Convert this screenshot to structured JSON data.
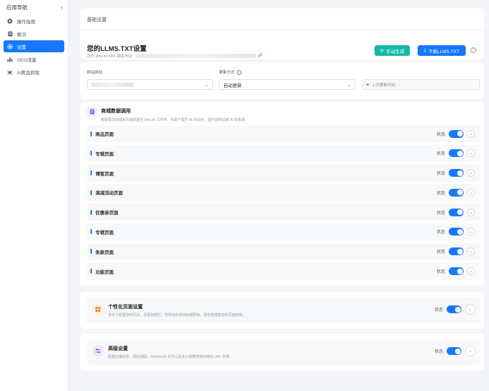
{
  "sidebar": {
    "title": "应用导航",
    "collapse_icon": "chevron-left-icon",
    "items": [
      {
        "label": "操作指南",
        "icon": "compass-icon",
        "active": false
      },
      {
        "label": "概况",
        "icon": "document-icon",
        "active": false
      },
      {
        "label": "设置",
        "icon": "gear-icon",
        "active": true
      },
      {
        "label": "GEO流量",
        "icon": "bar-chart-icon",
        "active": false
      },
      {
        "label": "AI爬虫抓取",
        "icon": "spider-icon",
        "active": false
      }
    ]
  },
  "header": {
    "breadcrumb": "基础设置",
    "title": "您的LLMS.TXT设置",
    "subtitle": "您的 llms.txt URL链接地址:",
    "manual_generate": "手动生成",
    "download": "下载LLMS.TXT"
  },
  "filters": {
    "site_label": "网站网址",
    "update_label": "更新方式",
    "update_value": "自动更新",
    "last_update": "上次更新时间：-"
  },
  "pages_section": {
    "title": "商城数据调用",
    "description": "新配置您商城的页面数据至 llms.txt 文件中，有助于提升 AI 的识别，提升您网站被 AI 的收录。",
    "status_label": "状态",
    "rows": [
      {
        "name": "商品页面",
        "enabled": true
      },
      {
        "name": "专辑页面",
        "enabled": true
      },
      {
        "name": "博客页面",
        "enabled": true
      },
      {
        "name": "满减活动页面",
        "enabled": true
      },
      {
        "name": "优惠券页面",
        "enabled": true
      },
      {
        "name": "专辑页面",
        "enabled": true
      },
      {
        "name": "条款页面",
        "enabled": true
      },
      {
        "name": "功能页面",
        "enabled": true
      }
    ]
  },
  "custom_section": {
    "title": "个性化页面设置",
    "description": "自定义配置您的页头、页尾标题栏，支持动态添加标题层级，轻松管理复杂的页面结构。",
    "status_label": "状态",
    "enabled": true
  },
  "advanced_section": {
    "title": "高级设置",
    "description": "配置店铺信息、网站地图、Robots.txt 文件以及定义需要排除的特定 URL 列表。",
    "status_label": "状态",
    "enabled": true
  },
  "colors": {
    "primary": "#1677ff",
    "success": "#14b8a6"
  }
}
